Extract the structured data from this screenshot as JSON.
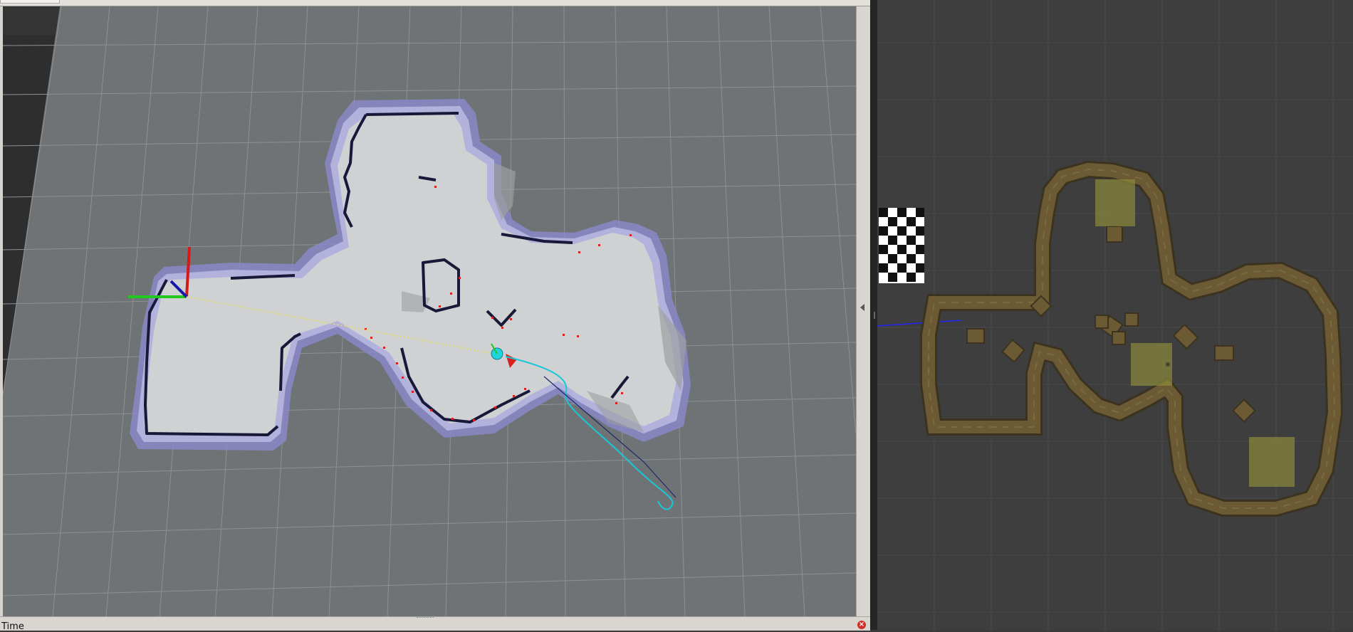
{
  "rviz": {
    "time_panel": {
      "label": "Time",
      "close_icon": "close-icon"
    },
    "splitter_icon": "collapse-arrow-icon"
  },
  "gazebo": {
    "marker_icon": "checkerboard-icon"
  },
  "colors": {
    "grid_floor": "#6f7375",
    "map_free": "#cfd1d3",
    "inflation": "#8a88c8",
    "obstacle": "#181838",
    "laser": "#e02020",
    "path": "#18c8d8",
    "gazebo_bg": "#3e3e3e",
    "gazebo_wall": "#6b5a33"
  }
}
